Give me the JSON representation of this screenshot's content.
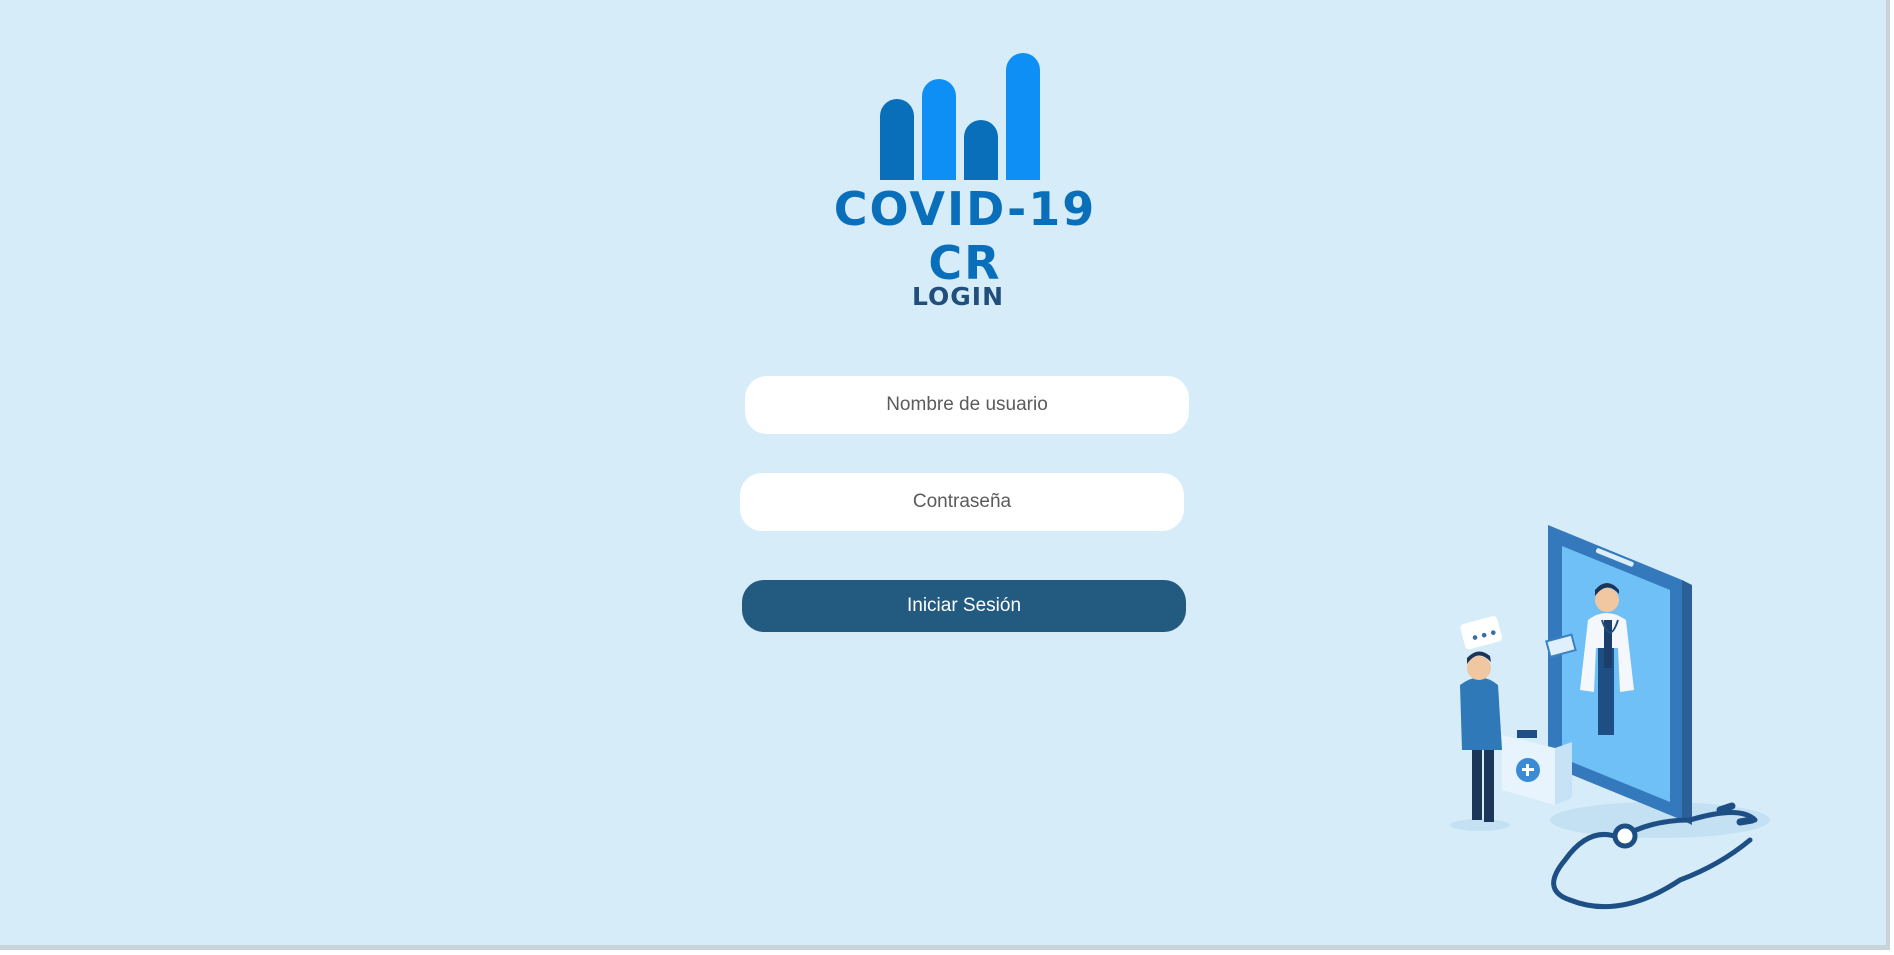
{
  "brand": {
    "name": "COVID-19 CR",
    "bar_heights": [
      0.62,
      0.78,
      0.46,
      0.98
    ],
    "bar_colors": [
      "#0a6fbb",
      "#0d8ff5",
      "#0a6fbb",
      "#0d8ff5"
    ],
    "text_color": "#0a6fbb"
  },
  "login": {
    "title": "LOGIN",
    "username_placeholder": "Nombre de usuario",
    "password_placeholder": "Contraseña",
    "submit_label": "Iniciar Sesión"
  },
  "colors": {
    "background": "#d6ecf9",
    "button": "#225a80",
    "title": "#1f4f7a"
  },
  "illustration": {
    "icon": "telemedicine-illustration",
    "chat_bubble": "•••"
  }
}
